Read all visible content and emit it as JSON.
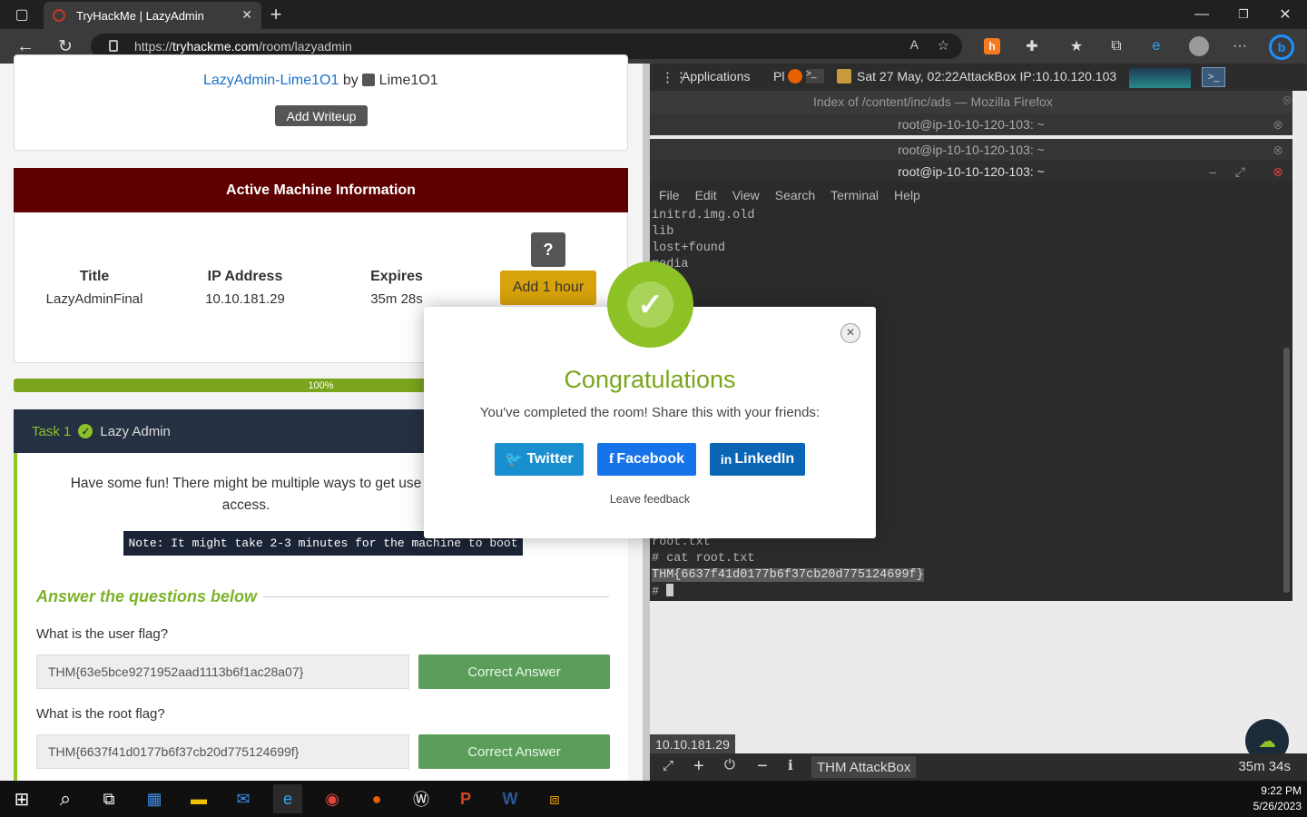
{
  "browser": {
    "tab_title": "TryHackMe | LazyAdmin",
    "url_prefix": "https://",
    "url_host": "tryhackme.com",
    "url_path": "/room/lazyadmin"
  },
  "writeups": {
    "link": "LazyAdmin-Lime1O1",
    "by": "by",
    "author": "Lime1O1",
    "add_writeup": "Add Writeup"
  },
  "machine": {
    "header": "Active Machine Information",
    "help": "?",
    "col_title": "Title",
    "col_title_value": "LazyAdminFinal",
    "col_ip": "IP Address",
    "col_ip_value": "10.10.181.29",
    "col_expires": "Expires",
    "col_expires_value": "35m 28s",
    "add_hour": "Add 1 hour"
  },
  "progress": {
    "label": "100%",
    "value": 100
  },
  "task": {
    "number": "Task 1",
    "name": "Lazy Admin",
    "description_1": "Have some fun! There might be multiple ways to get use",
    "description_2": "access.",
    "note": "Note: It might take 2-3 minutes for the machine to boot",
    "questions_header": "Answer the questions below",
    "questions": [
      {
        "question": "What is the user flag?",
        "answer": "THM{63e5bce9271952aad1113b6f1ac28a07}",
        "status": "Correct Answer"
      },
      {
        "question": "What is the root flag?",
        "answer": "THM{6637f41d0177b6f37cb20d775124699f}",
        "status": "Correct Answer"
      }
    ]
  },
  "attackbox": {
    "applications": "Applications",
    "places": "Pl",
    "clock_ip": "Sat 27 May, 02:22AttackBox IP:10.10.120.103",
    "firefox_title": "Index of /content/inc/ads — Mozilla Firefox",
    "term_tabs": [
      "root@ip-10-10-120-103: ~",
      "root@ip-10-10-120-103: ~",
      "root@ip-10-10-120-103: ~"
    ],
    "menu": [
      "File",
      "Edit",
      "View",
      "Search",
      "Terminal",
      "Help"
    ],
    "lines_top": [
      "initrd.img.old",
      "lib",
      "lost+found",
      "media"
    ],
    "lines_bottom": [
      "root.txt",
      "# cat root.txt"
    ],
    "flag_line": "THM{6637f41d0177b6f37cb20d775124699f}",
    "prompt": "#",
    "ip_label": "10.10.181.29",
    "bottom_title": "THM AttackBox",
    "bottom_timer": "35m 34s"
  },
  "modal": {
    "title": "Congratulations",
    "message": "You've completed the room! Share this with your friends:",
    "twitter": "Twitter",
    "facebook": "Facebook",
    "linkedin": "LinkedIn",
    "feedback": "Leave feedback",
    "close": "×"
  },
  "taskbar": {
    "time": "9:22 PM",
    "date": "5/26/2023"
  },
  "colors": {
    "brand_green": "#8dc227",
    "machine_header": "#5e0000",
    "share_blue": "#1a8fd0"
  }
}
